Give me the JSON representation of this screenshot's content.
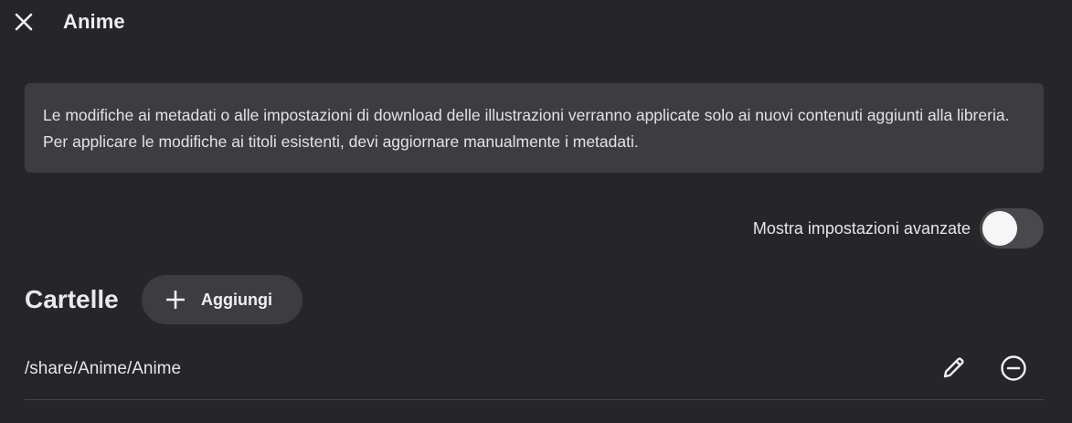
{
  "header": {
    "title": "Anime",
    "close_icon": "close-icon"
  },
  "notice": {
    "text": "Le modifiche ai metadati o alle impostazioni di download delle illustrazioni verranno applicate solo ai nuovi contenuti aggiunti alla libreria. Per applicare le modifiche ai titoli esistenti, devi aggiornare manualmente i metadati."
  },
  "advanced": {
    "label": "Mostra impostazioni avanzate",
    "enabled": false
  },
  "folders": {
    "title": "Cartelle",
    "add_label": "Aggiungi",
    "add_icon": "plus-icon",
    "items": [
      {
        "path": "/share/Anime/Anime",
        "edit_icon": "pencil-icon",
        "remove_icon": "minus-circle-icon"
      }
    ]
  },
  "colors": {
    "background": "#262528",
    "panel": "#3d3c41",
    "text": "#e8e8ea",
    "divider": "#46454a"
  }
}
